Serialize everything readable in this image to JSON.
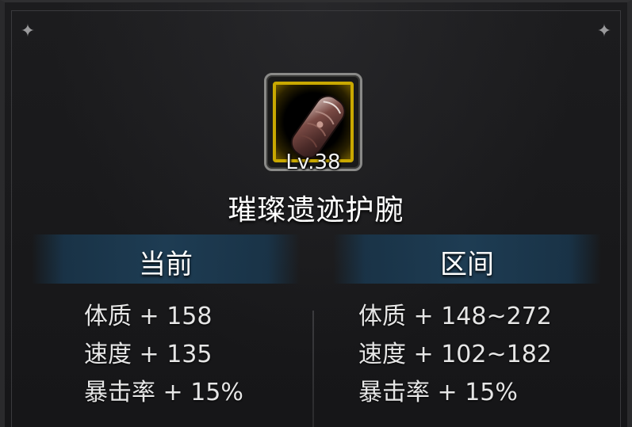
{
  "item": {
    "level_text": "Lv.38",
    "name": "璀璨遗迹护腕",
    "icon": "bracer-icon",
    "rarity_color": "#c9a800"
  },
  "columns": {
    "current": {
      "header": "当前",
      "stats": [
        "体质 + 158",
        "速度 + 135",
        "暴击率 + 15%"
      ]
    },
    "range": {
      "header": "区间",
      "stats": [
        "体质 + 148~272",
        "速度 + 102~182",
        "暴击率 + 15%"
      ]
    }
  },
  "decorations": {
    "corner_glyph": "✦"
  }
}
